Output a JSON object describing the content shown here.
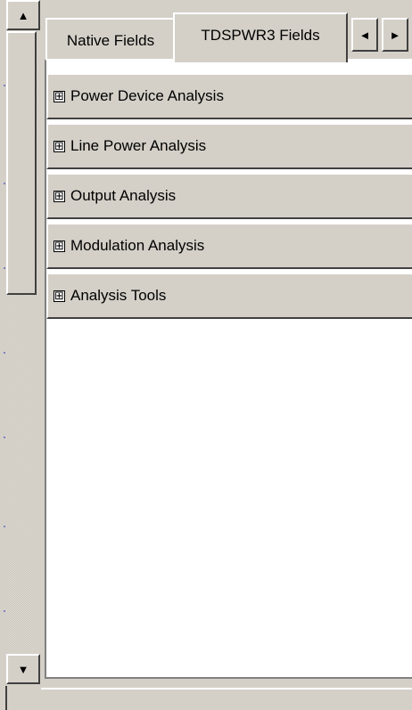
{
  "scrollbar": {
    "up_glyph": "▲",
    "down_glyph": "▼"
  },
  "tabs": [
    {
      "label": "Native Fields"
    },
    {
      "label": "TDSPWR3 Fields"
    }
  ],
  "tab_nav": {
    "left_glyph": "◄",
    "right_glyph": "►"
  },
  "groups": [
    {
      "label": "Power Device Analysis",
      "toggle": "⊞"
    },
    {
      "label": "Line Power Analysis",
      "toggle": "⊞"
    },
    {
      "label": "Output Analysis",
      "toggle": "⊞"
    },
    {
      "label": "Modulation Analysis",
      "toggle": "⊞"
    },
    {
      "label": "Analysis Tools",
      "toggle": "⊞"
    }
  ],
  "colors": {
    "face": "#d4d0c8",
    "content_bg": "#ffffff"
  }
}
